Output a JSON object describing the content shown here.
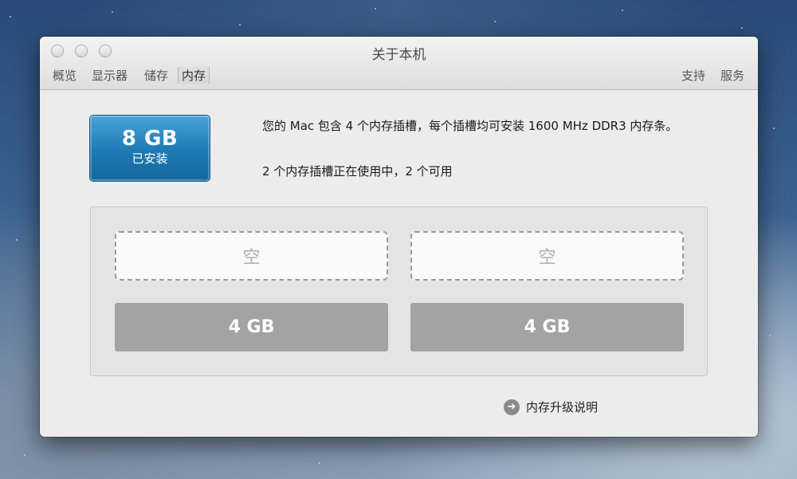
{
  "window": {
    "title": "关于本机"
  },
  "tabs": {
    "overview": "概览",
    "displays": "显示器",
    "storage": "储存",
    "memory": "内存",
    "support": "支持",
    "service": "服务"
  },
  "memory": {
    "installed_amount": "8 GB",
    "installed_label": "已安装",
    "description": "您的 Mac 包含 4 个内存插槽，每个插槽均可安装 1600 MHz DDR3 内存条。",
    "slots_status": "2 个内存插槽正在使用中，2 个可用",
    "slots": {
      "slot1": "空",
      "slot2": "空",
      "slot3": "4 GB",
      "slot4": "4 GB"
    },
    "upgrade_link": "内存升级说明"
  }
}
